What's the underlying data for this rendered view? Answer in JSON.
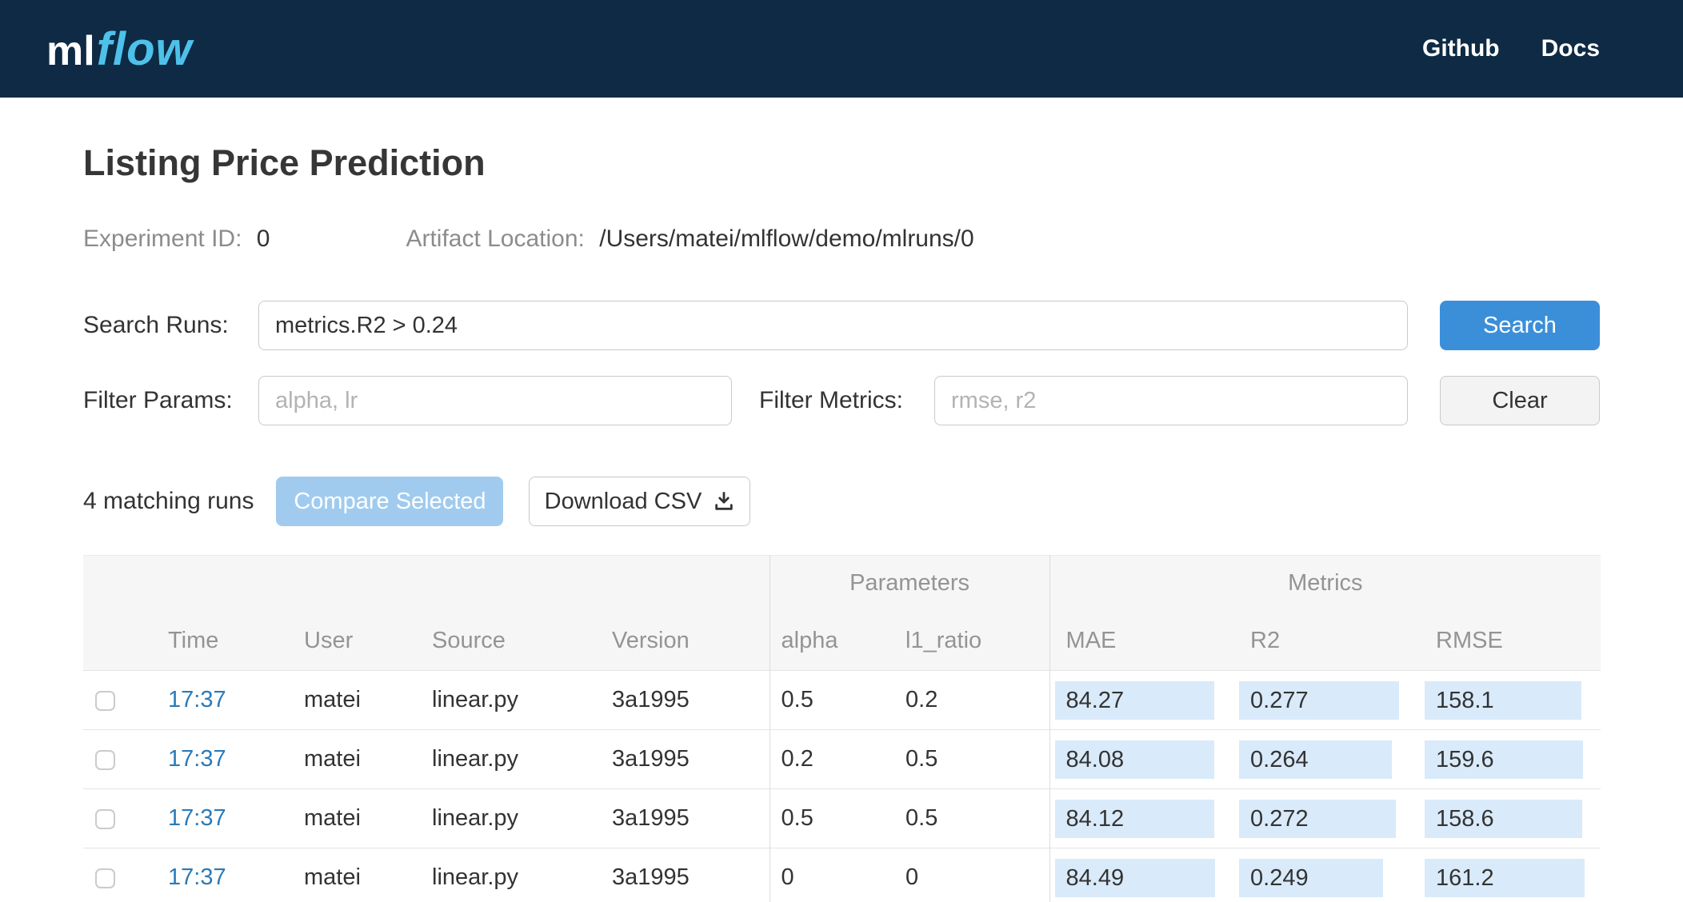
{
  "colors": {
    "header_bg": "#0e2a44",
    "logo_flow": "#4ec1ea",
    "link": "#2a7ab9",
    "primary_button": "#3b8fd9",
    "compare_button_bg": "#a1cbee",
    "metric_bar_bg": "#d9eafa"
  },
  "header": {
    "logo_ml": "ml",
    "logo_flow": "flow",
    "nav": [
      {
        "label": "Github"
      },
      {
        "label": "Docs"
      }
    ]
  },
  "page": {
    "title": "Listing Price Prediction",
    "experiment_id_label": "Experiment ID:",
    "experiment_id_value": "0",
    "artifact_location_label": "Artifact Location:",
    "artifact_location_value": "/Users/matei/mlflow/demo/mlruns/0"
  },
  "search": {
    "label": "Search Runs:",
    "value": "metrics.R2 > 0.24",
    "button_label": "Search"
  },
  "filters": {
    "params_label": "Filter Params:",
    "params_placeholder": "alpha, lr",
    "metrics_label": "Filter Metrics:",
    "metrics_placeholder": "rmse, r2",
    "clear_button_label": "Clear"
  },
  "actions": {
    "matching_runs_text": "4 matching runs",
    "compare_button_label": "Compare Selected",
    "download_button_label": "Download CSV"
  },
  "table": {
    "group_headers": {
      "parameters": "Parameters",
      "metrics": "Metrics"
    },
    "columns": {
      "time": "Time",
      "user": "User",
      "source": "Source",
      "version": "Version",
      "alpha": "alpha",
      "l1_ratio": "l1_ratio",
      "mae": "MAE",
      "r2": "R2",
      "rmse": "RMSE"
    },
    "rows": [
      {
        "time": "17:37",
        "user": "matei",
        "source": "linear.py",
        "version": "3a1995",
        "alpha": "0.5",
        "l1_ratio": "0.2",
        "mae": "84.27",
        "r2": "0.277",
        "rmse": "158.1"
      },
      {
        "time": "17:37",
        "user": "matei",
        "source": "linear.py",
        "version": "3a1995",
        "alpha": "0.2",
        "l1_ratio": "0.5",
        "mae": "84.08",
        "r2": "0.264",
        "rmse": "159.6"
      },
      {
        "time": "17:37",
        "user": "matei",
        "source": "linear.py",
        "version": "3a1995",
        "alpha": "0.5",
        "l1_ratio": "0.5",
        "mae": "84.12",
        "r2": "0.272",
        "rmse": "158.6"
      },
      {
        "time": "17:37",
        "user": "matei",
        "source": "linear.py",
        "version": "3a1995",
        "alpha": "0",
        "l1_ratio": "0",
        "mae": "84.49",
        "r2": "0.249",
        "rmse": "161.2"
      }
    ]
  }
}
